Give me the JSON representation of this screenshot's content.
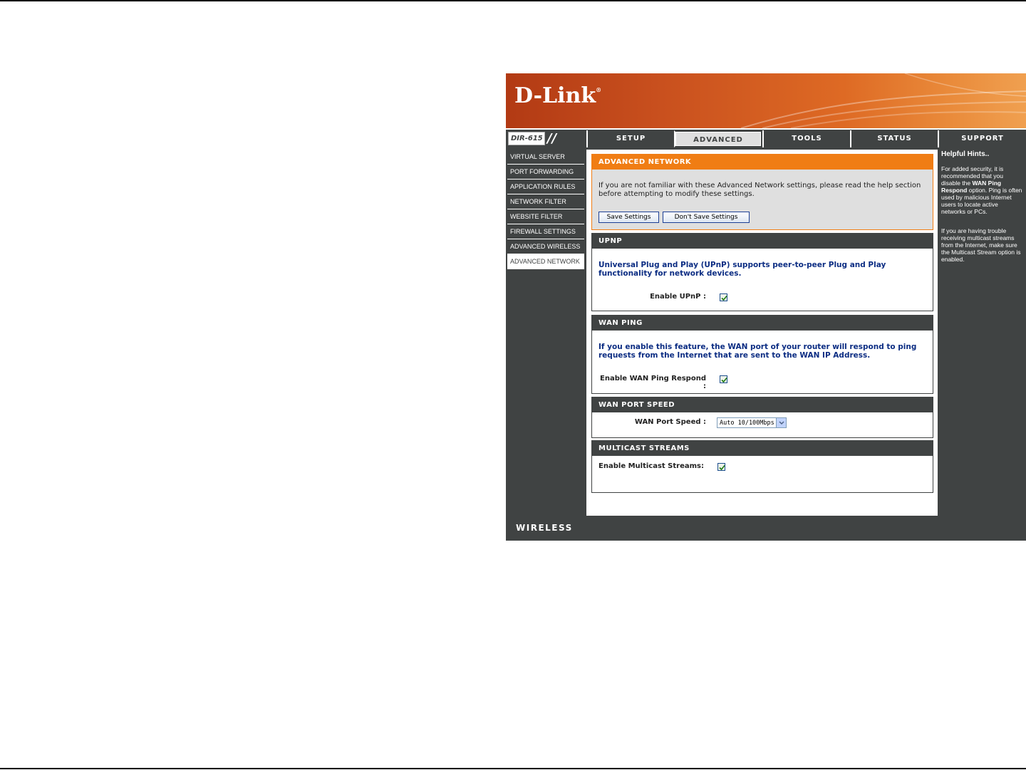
{
  "brand": {
    "logo": "D-Link",
    "model": "DIR-615",
    "footer": "WIRELESS"
  },
  "nav": {
    "tabs": [
      {
        "label": "SETUP",
        "active": false
      },
      {
        "label": "ADVANCED",
        "active": true
      },
      {
        "label": "TOOLS",
        "active": false
      },
      {
        "label": "STATUS",
        "active": false
      },
      {
        "label": "SUPPORT",
        "active": false
      }
    ]
  },
  "sidebar": {
    "items": [
      {
        "label": "VIRTUAL SERVER"
      },
      {
        "label": "PORT FORWARDING"
      },
      {
        "label": "APPLICATION RULES"
      },
      {
        "label": "NETWORK FILTER"
      },
      {
        "label": "WEBSITE FILTER"
      },
      {
        "label": "FIREWALL SETTINGS"
      },
      {
        "label": "ADVANCED WIRELESS"
      },
      {
        "label": "ADVANCED NETWORK"
      }
    ],
    "active": "ADVANCED NETWORK"
  },
  "advanced_network": {
    "title": "ADVANCED NETWORK",
    "intro": "If you are not familiar with these Advanced Network settings, please read the help section before attempting to modify these settings.",
    "save_label": "Save Settings",
    "dont_save_label": "Don't Save Settings"
  },
  "upnp": {
    "title": "UPNP",
    "description": "Universal Plug and Play (UPnP) supports peer-to-peer Plug and Play functionality for network devices.",
    "enable_label": "Enable UPnP :",
    "enabled": true
  },
  "wan_ping": {
    "title": "WAN PING",
    "description": "If you enable this feature, the WAN port of your router will respond to ping requests from the Internet that are sent to the WAN IP Address.",
    "enable_label": "Enable WAN Ping Respond :",
    "enabled": true
  },
  "wan_port_speed": {
    "title": "WAN PORT SPEED",
    "label": "WAN Port Speed :",
    "selected": "Auto 10/100Mbps"
  },
  "multicast": {
    "title": "MULTICAST STREAMS",
    "enable_label": "Enable Multicast Streams:",
    "enabled": true
  },
  "hints": {
    "title": "Helpful Hints..",
    "p1_a": "For added security, it is recommended that you disable the ",
    "p1_bold": "WAN Ping Respond",
    "p1_b": " option. Ping is often used by malicious Internet users to locate active networks or PCs.",
    "p2": "If you are having trouble receiving multicast streams from the Internet, make sure the Multicast Stream option is enabled."
  },
  "colors": {
    "frame": "#404343",
    "accent_orange": "#f07d14",
    "link_blue": "#0c2d83"
  }
}
